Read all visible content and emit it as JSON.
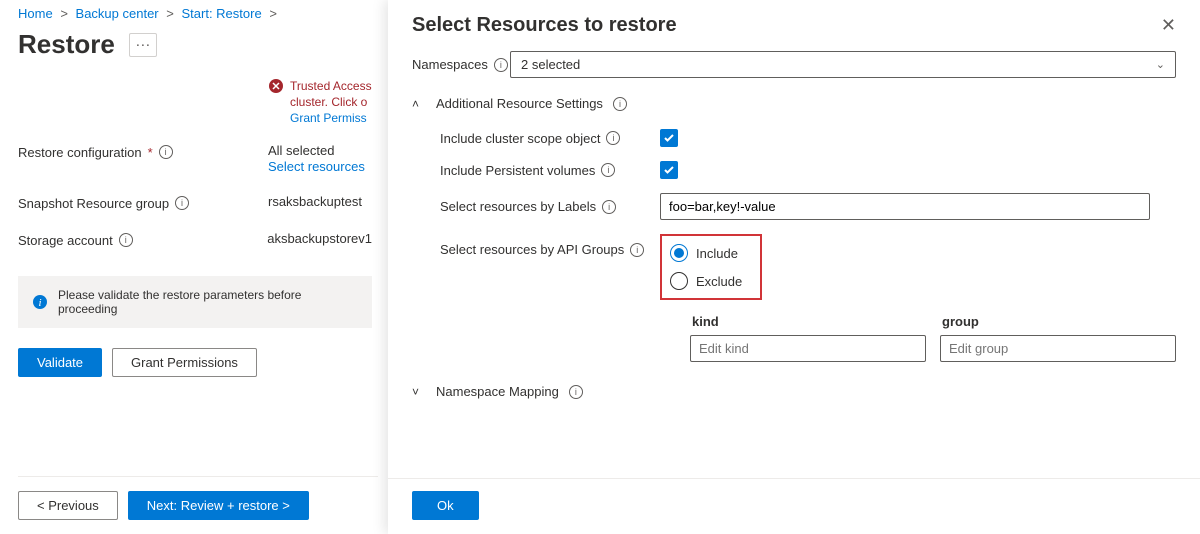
{
  "breadcrumb": {
    "items": [
      "Home",
      "Backup center",
      "Start: Restore"
    ]
  },
  "page": {
    "title": "Restore",
    "more": "···"
  },
  "error": {
    "line1": "Trusted Access",
    "line2": "cluster. Click o",
    "link": "Grant Permiss"
  },
  "form": {
    "restore_config_label": "Restore configuration",
    "restore_config_value": "All selected",
    "restore_config_link": "Select resources",
    "snapshot_rg_label": "Snapshot Resource group",
    "snapshot_rg_value": "rsaksbackuptest",
    "storage_label": "Storage account",
    "storage_value": "aksbackupstorev1"
  },
  "banner": {
    "text": "Please validate the restore parameters before proceeding"
  },
  "buttons": {
    "validate": "Validate",
    "grant": "Grant Permissions",
    "prev": "< Previous",
    "next": "Next: Review + restore >",
    "ok": "Ok"
  },
  "panel": {
    "title": "Select Resources to restore",
    "namespaces_label": "Namespaces",
    "namespaces_value": "2 selected",
    "section_additional": "Additional Resource Settings",
    "include_cluster_scope": "Include cluster scope object",
    "include_pv": "Include Persistent volumes",
    "by_labels_label": "Select resources by Labels",
    "by_labels_value": "foo=bar,key!-value",
    "by_api_label": "Select resources by API Groups",
    "radio_include": "Include",
    "radio_exclude": "Exclude",
    "kind_head": "kind",
    "kind_placeholder": "Edit kind",
    "group_head": "group",
    "group_placeholder": "Edit group",
    "section_ns_mapping": "Namespace Mapping"
  }
}
